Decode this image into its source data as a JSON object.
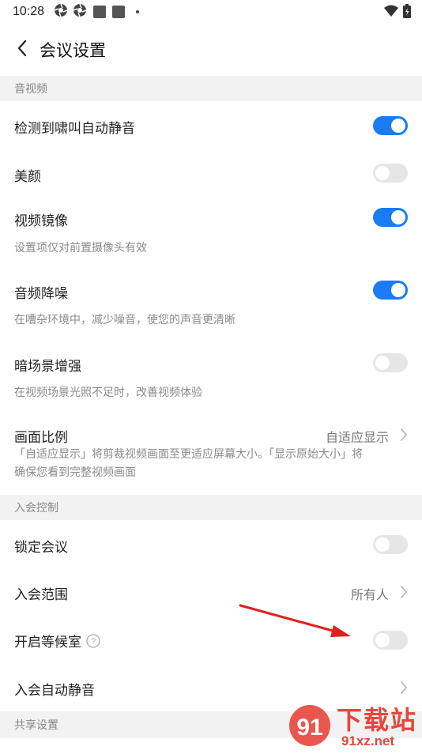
{
  "status": {
    "time": "10:28"
  },
  "header": {
    "title": "会议设置"
  },
  "sections": {
    "av": "音视频",
    "join": "入会控制",
    "share": "共享设置"
  },
  "rows": {
    "howl_mute": {
      "label": "检测到啸叫自动静音",
      "on": true
    },
    "beauty": {
      "label": "美颜",
      "on": false
    },
    "mirror": {
      "label": "视频镜像",
      "desc": "设置项仅对前置摄像头有效",
      "on": true
    },
    "noise": {
      "label": "音频降噪",
      "desc": "在嘈杂环境中，减少噪音，使您的声音更清晰",
      "on": true
    },
    "dark": {
      "label": "暗场景增强",
      "desc": "在视频场景光照不足时，改善视频体验",
      "on": false
    },
    "ratio": {
      "label": "画面比例",
      "value": "自适应显示",
      "desc1": "「自适应显示」将剪裁视频画面至更适应屏幕大小。「显示原始大小」将",
      "desc2": "确保您看到完整视频画面"
    },
    "lock": {
      "label": "锁定会议",
      "on": false
    },
    "range": {
      "label": "入会范围",
      "value": "所有人"
    },
    "waiting": {
      "label": "开启等候室",
      "on": false
    },
    "auto_mute": {
      "label": "入会自动静音"
    }
  },
  "watermark": {
    "big": "下载站",
    "small": "91xz.net"
  }
}
